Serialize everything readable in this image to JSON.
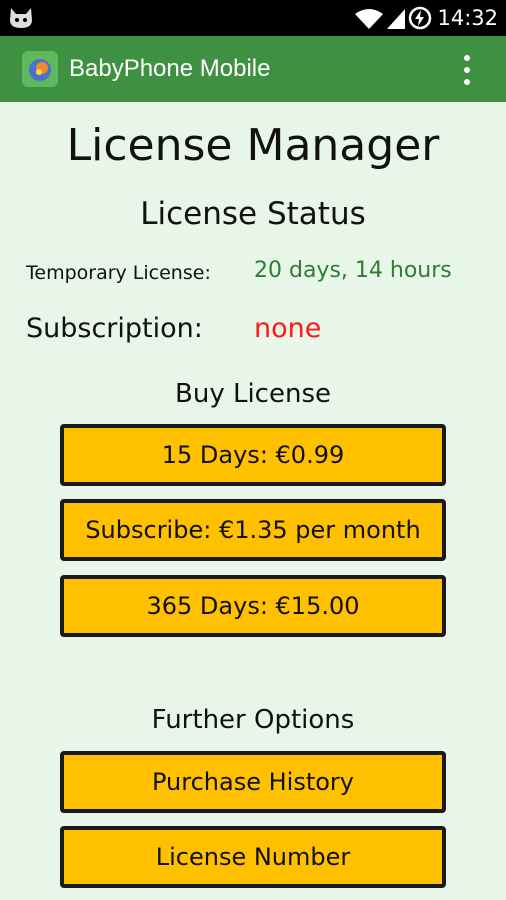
{
  "statusbar": {
    "time": "14:32",
    "icons": [
      "android-cat-icon",
      "wifi-icon",
      "signal-icon",
      "battery-charging-icon"
    ]
  },
  "appbar": {
    "title": "BabyPhone Mobile",
    "menu_icon": "overflow-menu-icon"
  },
  "page": {
    "title": "License Manager"
  },
  "status": {
    "heading": "License Status",
    "temporary_label": "Temporary License:",
    "temporary_value": "20 days, 14 hours",
    "subscription_label": "Subscription:",
    "subscription_value": "none"
  },
  "buy": {
    "heading": "Buy License",
    "options": [
      "15 Days: €0.99",
      "Subscribe: €1.35 per month",
      "365 Days: €15.00"
    ]
  },
  "further": {
    "heading": "Further Options",
    "options": [
      "Purchase History",
      "License Number"
    ]
  },
  "colors": {
    "appbar": "#3f9142",
    "background": "#e8f5e9",
    "button": "#ffc000",
    "temporary_value": "#2e7d32",
    "subscription_value": "#ff1a1a"
  }
}
